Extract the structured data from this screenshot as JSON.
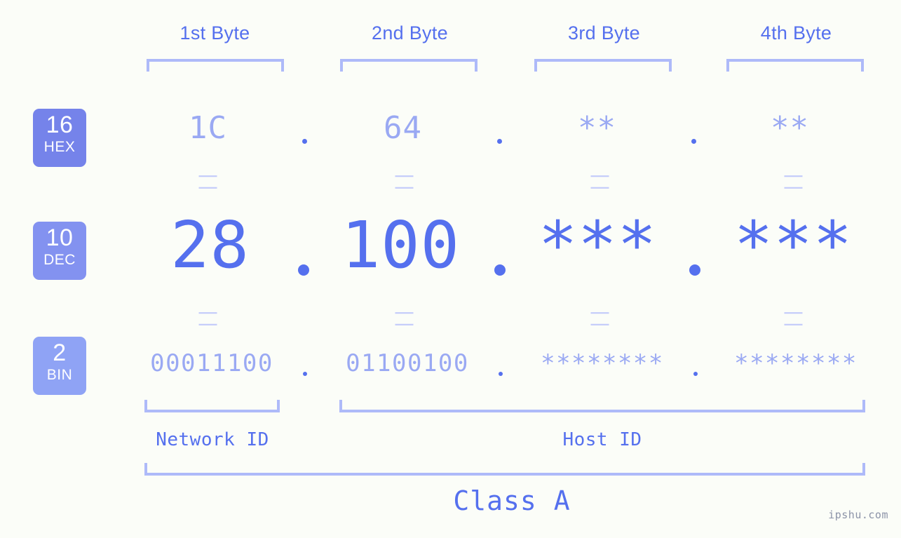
{
  "meta": {
    "background": "#fbfdf8",
    "accent": "#5570ee",
    "accent_light": "#9aa9f3",
    "bracket_color": "#aebaf9",
    "watermark": "ipshu.com"
  },
  "byte_headers": [
    {
      "label": "1st Byte"
    },
    {
      "label": "2nd Byte"
    },
    {
      "label": "3rd Byte"
    },
    {
      "label": "4th Byte"
    }
  ],
  "bases": [
    {
      "num": "16",
      "abbr": "HEX",
      "color": "#7583ea"
    },
    {
      "num": "10",
      "abbr": "DEC",
      "color": "#8392f0"
    },
    {
      "num": "2",
      "abbr": "BIN",
      "color": "#8fa3f5"
    }
  ],
  "rows": {
    "hex": {
      "values": [
        "1C",
        "64",
        "**",
        "**"
      ]
    },
    "dec": {
      "values": [
        "28",
        "100",
        "***",
        "***"
      ]
    },
    "bin": {
      "values": [
        "00011100",
        "01100100",
        "********",
        "********"
      ]
    }
  },
  "separators": {
    "hex_dot": ".",
    "dec_dot": ".",
    "bin_dot": ".",
    "equals": "||"
  },
  "sections": [
    {
      "label": "Network ID"
    },
    {
      "label": "Host ID"
    }
  ],
  "class": {
    "label": "Class A"
  }
}
